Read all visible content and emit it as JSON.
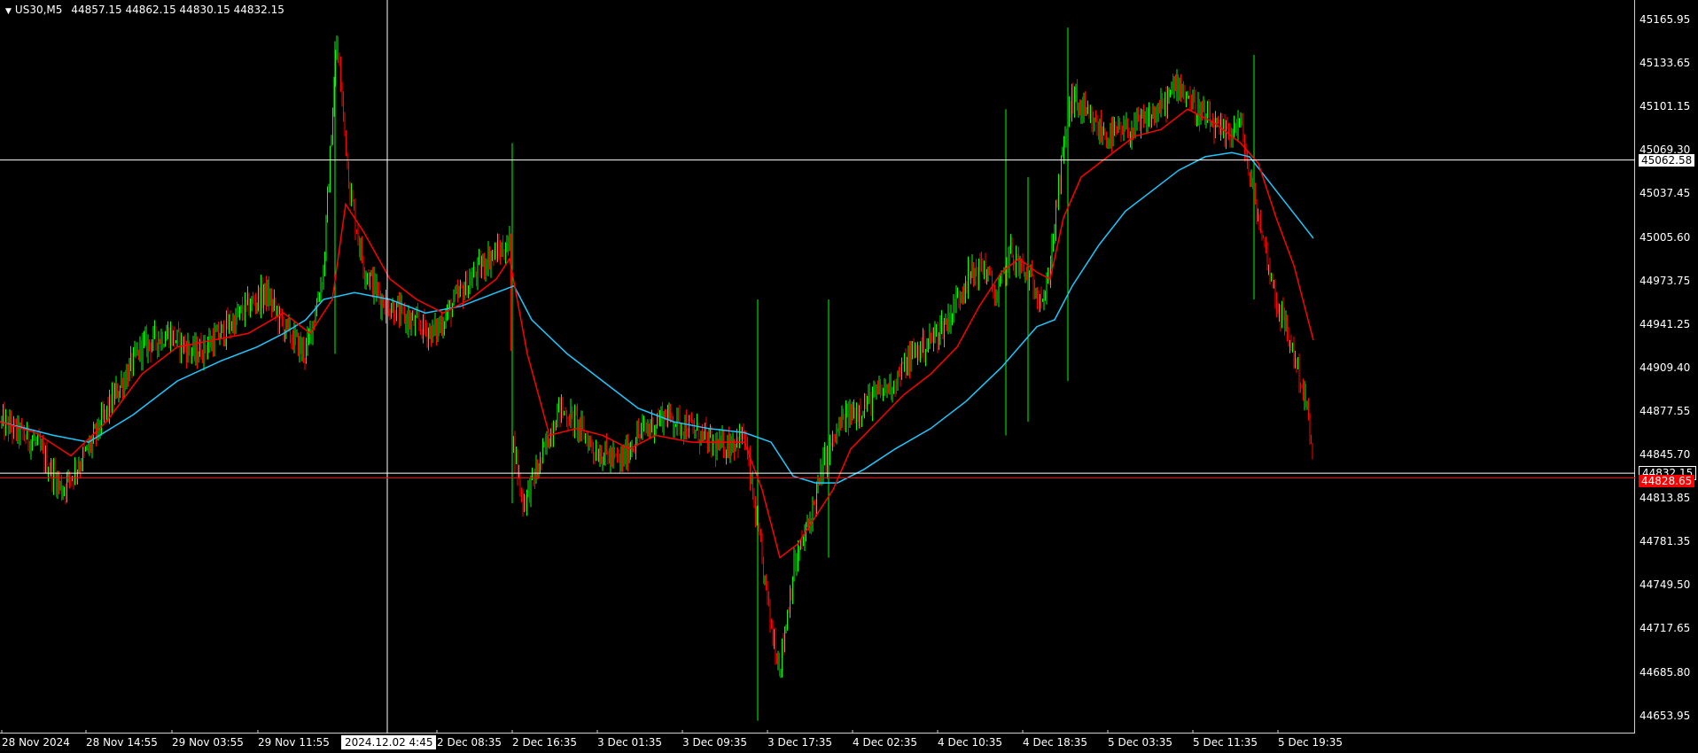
{
  "header": {
    "symbol": "US30,M5",
    "ohlc": "44857.15 44862.15 44830.15 44832.15",
    "menu_arrow_icon": "triangle-down-icon"
  },
  "crosshair": {
    "price_tag": "45062.58",
    "time_tag": "2024.12.02 4:45"
  },
  "price_tags": {
    "bid": "44832.15",
    "ask": "44828.65"
  },
  "colors": {
    "background": "#000000",
    "bull_candle": "#00ff00",
    "bear_candle": "#ff0000",
    "ma_fast": "#ff0000",
    "ma_slow": "#1ec8ff",
    "crosshair": "#ffffff",
    "bid_line": "#ffffff",
    "ask_line": "#ff0000"
  },
  "chart_data": {
    "type": "candlestick",
    "price_axis_labels": [
      "45165.95",
      "45133.65",
      "45101.15",
      "45069.30",
      "45037.45",
      "45005.60",
      "44973.75",
      "44941.25",
      "44909.40",
      "44877.55",
      "44845.70",
      "44813.85",
      "44781.35",
      "44749.50",
      "44717.65",
      "44685.80",
      "44653.95"
    ],
    "time_axis_labels": [
      "28 Nov 2024",
      "28 Nov 14:55",
      "29 Nov 03:55",
      "29 Nov 11:55",
      "2 Dec 08:35",
      "2 Dec 16:35",
      "3 Dec 01:35",
      "3 Dec 09:35",
      "3 Dec 17:35",
      "4 Dec 02:35",
      "4 Dec 10:35",
      "4 Dec 18:35",
      "5 Dec 03:35",
      "5 Dec 11:35",
      "5 Dec 19:35"
    ],
    "ylim": [
      44640,
      45180
    ],
    "close_path": [
      [
        0,
        44870
      ],
      [
        40,
        44855
      ],
      [
        70,
        44820
      ],
      [
        100,
        44850
      ],
      [
        130,
        44890
      ],
      [
        160,
        44925
      ],
      [
        190,
        44935
      ],
      [
        220,
        44920
      ],
      [
        250,
        44935
      ],
      [
        280,
        44955
      ],
      [
        300,
        44965
      ],
      [
        320,
        44940
      ],
      [
        345,
        44920
      ],
      [
        365,
        44980
      ],
      [
        380,
        45150
      ],
      [
        395,
        45040
      ],
      [
        410,
        44985
      ],
      [
        430,
        44960
      ],
      [
        460,
        44945
      ],
      [
        490,
        44935
      ],
      [
        520,
        44965
      ],
      [
        550,
        44990
      ],
      [
        575,
        45000
      ],
      [
        578,
        44860
      ],
      [
        590,
        44810
      ],
      [
        610,
        44840
      ],
      [
        630,
        44880
      ],
      [
        650,
        44870
      ],
      [
        670,
        44850
      ],
      [
        700,
        44840
      ],
      [
        720,
        44860
      ],
      [
        750,
        44875
      ],
      [
        780,
        44865
      ],
      [
        810,
        44850
      ],
      [
        840,
        44860
      ],
      [
        855,
        44790
      ],
      [
        870,
        44720
      ],
      [
        880,
        44690
      ],
      [
        895,
        44760
      ],
      [
        915,
        44800
      ],
      [
        930,
        44840
      ],
      [
        950,
        44870
      ],
      [
        970,
        44880
      ],
      [
        990,
        44890
      ],
      [
        1010,
        44900
      ],
      [
        1030,
        44920
      ],
      [
        1050,
        44930
      ],
      [
        1070,
        44945
      ],
      [
        1090,
        44975
      ],
      [
        1110,
        44985
      ],
      [
        1125,
        44960
      ],
      [
        1140,
        44995
      ],
      [
        1160,
        44975
      ],
      [
        1180,
        44960
      ],
      [
        1200,
        45070
      ],
      [
        1210,
        45110
      ],
      [
        1230,
        45090
      ],
      [
        1250,
        45080
      ],
      [
        1280,
        45085
      ],
      [
        1310,
        45100
      ],
      [
        1330,
        45120
      ],
      [
        1350,
        45100
      ],
      [
        1380,
        45080
      ],
      [
        1400,
        45090
      ],
      [
        1410,
        45050
      ],
      [
        1420,
        45020
      ],
      [
        1440,
        44960
      ],
      [
        1460,
        44920
      ],
      [
        1475,
        44880
      ],
      [
        1482,
        44832
      ]
    ],
    "ma_fast_path": [
      [
        0,
        44870
      ],
      [
        40,
        44862
      ],
      [
        80,
        44845
      ],
      [
        120,
        44870
      ],
      [
        160,
        44905
      ],
      [
        200,
        44925
      ],
      [
        240,
        44930
      ],
      [
        280,
        44935
      ],
      [
        320,
        44950
      ],
      [
        350,
        44935
      ],
      [
        375,
        44960
      ],
      [
        390,
        45030
      ],
      [
        410,
        45010
      ],
      [
        440,
        44975
      ],
      [
        470,
        44960
      ],
      [
        500,
        44950
      ],
      [
        530,
        44960
      ],
      [
        560,
        44975
      ],
      [
        575,
        44990
      ],
      [
        595,
        44920
      ],
      [
        620,
        44860
      ],
      [
        650,
        44865
      ],
      [
        680,
        44860
      ],
      [
        710,
        44850
      ],
      [
        740,
        44860
      ],
      [
        780,
        44855
      ],
      [
        810,
        44855
      ],
      [
        840,
        44855
      ],
      [
        860,
        44820
      ],
      [
        880,
        44770
      ],
      [
        900,
        44780
      ],
      [
        920,
        44800
      ],
      [
        940,
        44820
      ],
      [
        960,
        44850
      ],
      [
        990,
        44870
      ],
      [
        1020,
        44890
      ],
      [
        1050,
        44905
      ],
      [
        1080,
        44925
      ],
      [
        1105,
        44955
      ],
      [
        1130,
        44980
      ],
      [
        1150,
        44990
      ],
      [
        1170,
        44980
      ],
      [
        1185,
        44975
      ],
      [
        1200,
        45020
      ],
      [
        1220,
        45050
      ],
      [
        1250,
        45065
      ],
      [
        1280,
        45080
      ],
      [
        1310,
        45085
      ],
      [
        1340,
        45100
      ],
      [
        1370,
        45090
      ],
      [
        1400,
        45075
      ],
      [
        1420,
        45060
      ],
      [
        1440,
        45020
      ],
      [
        1460,
        44985
      ],
      [
        1482,
        44930
      ]
    ],
    "ma_slow_path": [
      [
        0,
        44870
      ],
      [
        60,
        44860
      ],
      [
        100,
        44855
      ],
      [
        150,
        44875
      ],
      [
        200,
        44900
      ],
      [
        250,
        44915
      ],
      [
        290,
        44925
      ],
      [
        320,
        44935
      ],
      [
        345,
        44945
      ],
      [
        365,
        44960
      ],
      [
        400,
        44965
      ],
      [
        440,
        44960
      ],
      [
        480,
        44950
      ],
      [
        520,
        44955
      ],
      [
        560,
        44965
      ],
      [
        580,
        44970
      ],
      [
        600,
        44945
      ],
      [
        640,
        44920
      ],
      [
        680,
        44900
      ],
      [
        720,
        44880
      ],
      [
        760,
        44870
      ],
      [
        800,
        44865
      ],
      [
        840,
        44862
      ],
      [
        870,
        44855
      ],
      [
        895,
        44830
      ],
      [
        920,
        44825
      ],
      [
        945,
        44825
      ],
      [
        975,
        44835
      ],
      [
        1010,
        44850
      ],
      [
        1050,
        44865
      ],
      [
        1090,
        44885
      ],
      [
        1130,
        44910
      ],
      [
        1170,
        44940
      ],
      [
        1190,
        44945
      ],
      [
        1210,
        44970
      ],
      [
        1240,
        45000
      ],
      [
        1270,
        45025
      ],
      [
        1300,
        45040
      ],
      [
        1330,
        45055
      ],
      [
        1360,
        45065
      ],
      [
        1390,
        45068
      ],
      [
        1410,
        45065
      ],
      [
        1440,
        45040
      ],
      [
        1470,
        45015
      ],
      [
        1482,
        45005
      ]
    ],
    "crosshair_price": 45062.58,
    "bid_price": 44832.15,
    "ask_price": 44828.65
  }
}
